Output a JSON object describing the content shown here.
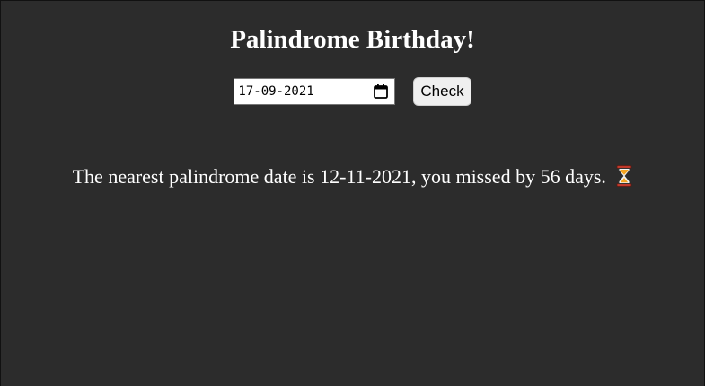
{
  "header": {
    "title": "Palindrome Birthday!"
  },
  "form": {
    "date_value": "17-09-2021",
    "check_label": "Check"
  },
  "result": {
    "message": "The nearest palindrome date is 12-11-2021, you missed by 56 days.",
    "icon": "hourglass-icon"
  },
  "colors": {
    "background": "#2c2c2c",
    "text": "#ffffff",
    "button": "#efefef"
  }
}
